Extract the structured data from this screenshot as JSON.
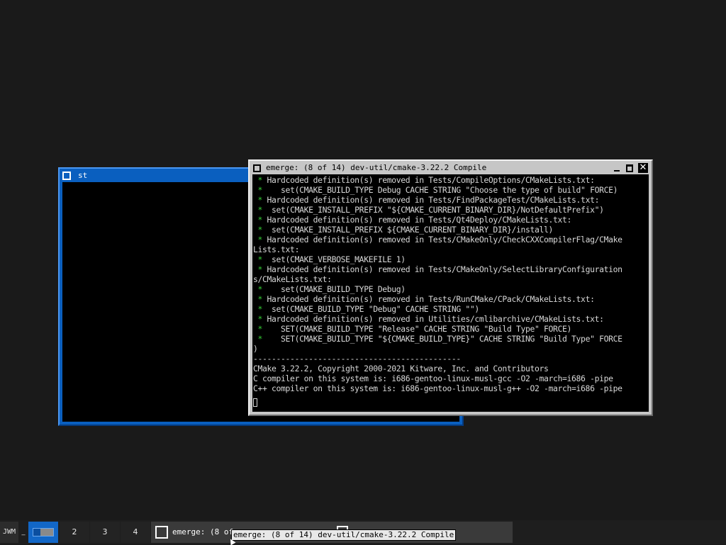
{
  "st_window": {
    "title": "st"
  },
  "emerge_window": {
    "title": "emerge: (8 of 14) dev-util/cmake-3.22.2 Compile",
    "close_glyph": "✕",
    "lines": [
      {
        "g": " * ",
        "t": "Hardcoded definition(s) removed in Tests/CompileOptions/CMakeLists.txt:"
      },
      {
        "g": " *   ",
        "t": " set(CMAKE_BUILD_TYPE Debug CACHE STRING \"Choose the type of build\" FORCE)"
      },
      {
        "g": " * ",
        "t": "Hardcoded definition(s) removed in Tests/FindPackageTest/CMakeLists.txt:"
      },
      {
        "g": " * ",
        "t": " set(CMAKE_INSTALL_PREFIX \"${CMAKE_CURRENT_BINARY_DIR}/NotDefaultPrefix\")"
      },
      {
        "g": " * ",
        "t": "Hardcoded definition(s) removed in Tests/Qt4Deploy/CMakeLists.txt:"
      },
      {
        "g": " * ",
        "t": " set(CMAKE_INSTALL_PREFIX ${CMAKE_CURRENT_BINARY_DIR}/install)"
      },
      {
        "g": " * ",
        "t": "Hardcoded definition(s) removed in Tests/CMakeOnly/CheckCXXCompilerFlag/CMake"
      },
      {
        "g": "",
        "t": "Lists.txt:"
      },
      {
        "g": " * ",
        "t": " set(CMAKE_VERBOSE_MAKEFILE 1)"
      },
      {
        "g": " * ",
        "t": "Hardcoded definition(s) removed in Tests/CMakeOnly/SelectLibraryConfiguration"
      },
      {
        "g": "",
        "t": "s/CMakeLists.txt:"
      },
      {
        "g": " *   ",
        "t": " set(CMAKE_BUILD_TYPE Debug)"
      },
      {
        "g": " * ",
        "t": "Hardcoded definition(s) removed in Tests/RunCMake/CPack/CMakeLists.txt:"
      },
      {
        "g": " * ",
        "t": " set(CMAKE_BUILD_TYPE \"Debug\" CACHE STRING \"\")"
      },
      {
        "g": " * ",
        "t": "Hardcoded definition(s) removed in Utilities/cmlibarchive/CMakeLists.txt:"
      },
      {
        "g": " *   ",
        "t": " SET(CMAKE_BUILD_TYPE \"Release\" CACHE STRING \"Build Type\" FORCE)"
      },
      {
        "g": " *   ",
        "t": " SET(CMAKE_BUILD_TYPE \"${CMAKE_BUILD_TYPE}\" CACHE STRING \"Build Type\" FORCE"
      },
      {
        "g": "",
        "t": ")"
      },
      {
        "g": "",
        "t": "---------------------------------------------"
      },
      {
        "g": "",
        "t": "CMake 3.22.2, Copyright 2000-2021 Kitware, Inc. and Contributors"
      },
      {
        "g": "",
        "t": "C compiler on this system is: i686-gentoo-linux-musl-gcc -O2 -march=i686 -pipe"
      },
      {
        "g": "",
        "t": "C++ compiler on this system is: i686-gentoo-linux-musl-g++ -O2 -march=i686 -pipe"
      }
    ]
  },
  "taskbar": {
    "menu_label": "JWM",
    "dash": "_",
    "desktops": [
      "2",
      "3",
      "4"
    ],
    "task_label": "emerge: (8 of",
    "tooltip": "emerge: (8 of 14) dev-util/cmake-3.22.2 Compile"
  }
}
